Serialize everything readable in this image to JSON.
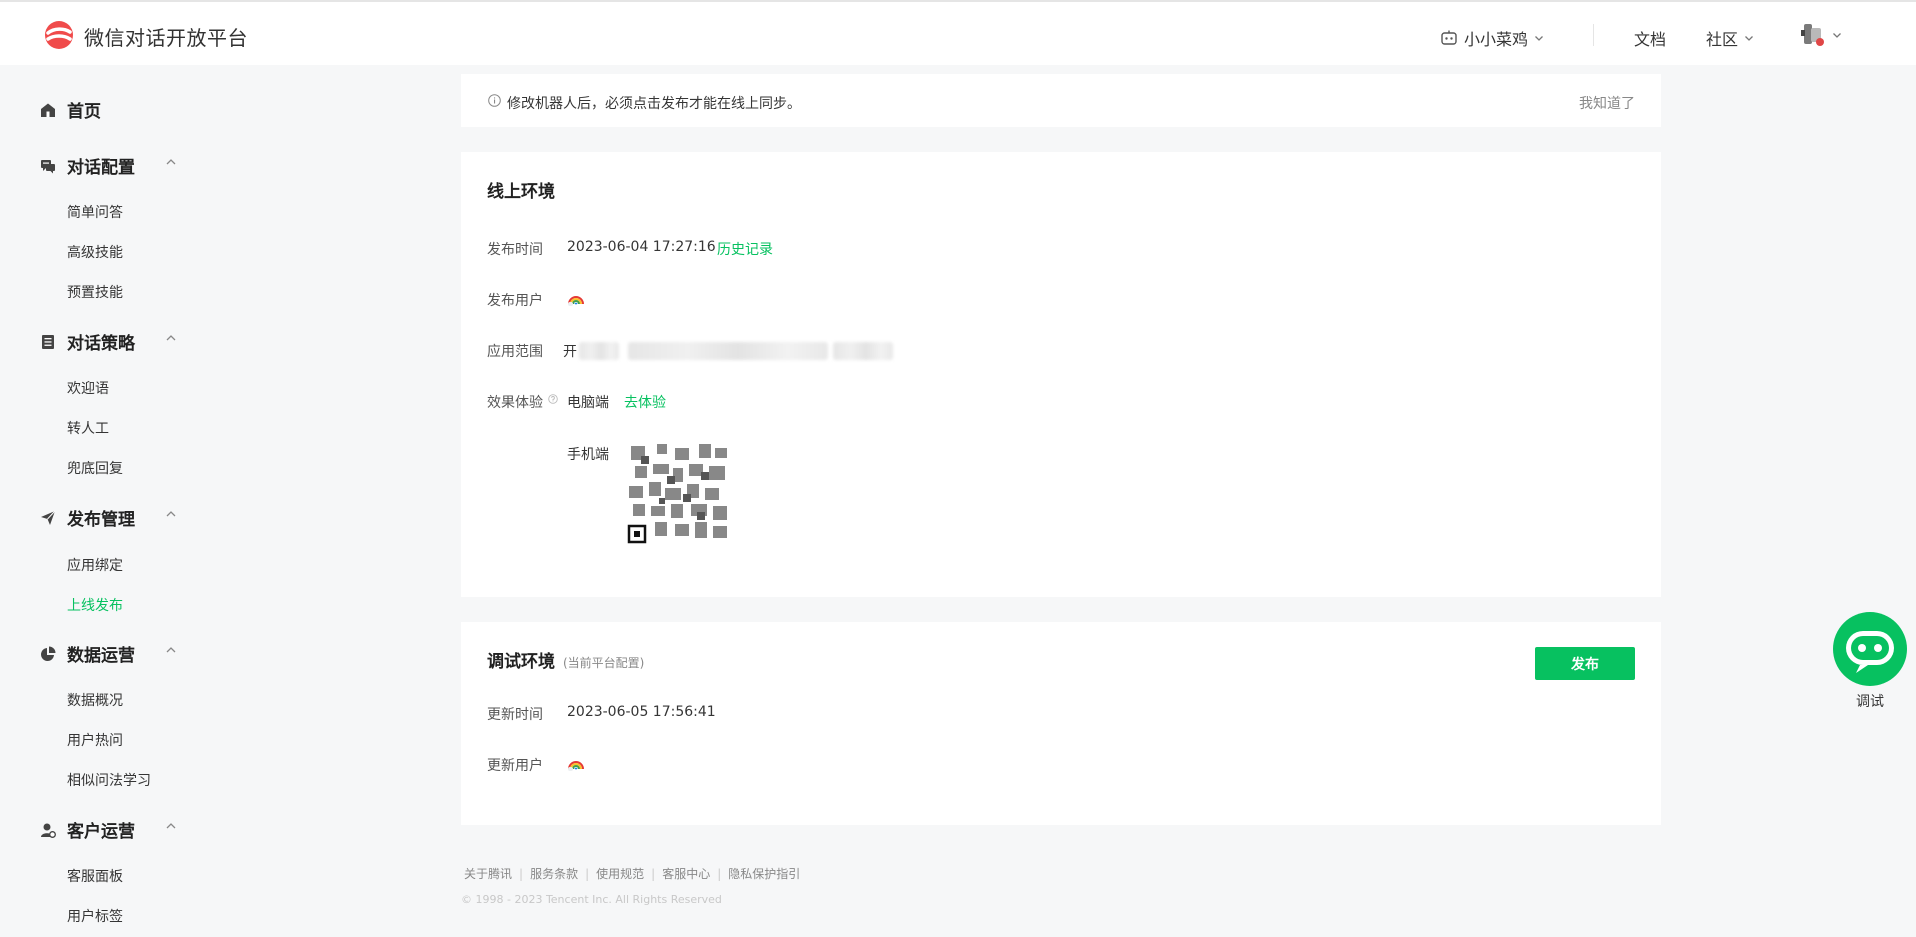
{
  "header": {
    "brand": "微信对话开放平台",
    "bot_name": "小小菜鸡",
    "docs": "文档",
    "community": "社区",
    "brand_color": "#f04b4b",
    "accent_color": "#07c160"
  },
  "sidebar": {
    "groups": [
      {
        "label": "首页",
        "icon": "home-icon"
      },
      {
        "label": "对话配置",
        "icon": "chat-icon",
        "items": [
          "简单问答",
          "高级技能",
          "预置技能"
        ]
      },
      {
        "label": "对话策略",
        "icon": "strategy-icon",
        "items": [
          "欢迎语",
          "转人工",
          "兜底回复"
        ]
      },
      {
        "label": "发布管理",
        "icon": "send-icon",
        "items": [
          "应用绑定",
          "上线发布"
        ]
      },
      {
        "label": "数据运营",
        "icon": "pie-chart-icon",
        "items": [
          "数据概况",
          "用户热问",
          "相似问法学习"
        ]
      },
      {
        "label": "客户运营",
        "icon": "customer-icon",
        "items": [
          "客服面板",
          "用户标签"
        ]
      }
    ],
    "active_item": "上线发布"
  },
  "notice": {
    "text": "修改机器人后，必须点击发布才能在线上同步。",
    "dismiss": "我知道了"
  },
  "online": {
    "title": "线上环境",
    "publish_time_label": "发布时间",
    "publish_time": "2023-06-04 17:27:16",
    "history_link": "历史记录",
    "publish_user_label": "发布用户",
    "scope_label": "应用范围",
    "scope_visible": "开",
    "experience_label": "效果体验",
    "pc_label": "电脑端",
    "try_link": "去体验",
    "mobile_label": "手机端"
  },
  "debug": {
    "title": "调试环境",
    "subtitle": "(当前平台配置)",
    "publish_button": "发布",
    "update_time_label": "更新时间",
    "update_time": "2023-06-05 17:56:41",
    "update_user_label": "更新用户"
  },
  "footer": {
    "links": [
      "关于腾讯",
      "服务条款",
      "使用规范",
      "客服中心",
      "隐私保护指引"
    ],
    "copyright": "© 1998 - 2023 Tencent Inc. All Rights Reserved"
  },
  "floating": {
    "label": "调试"
  }
}
